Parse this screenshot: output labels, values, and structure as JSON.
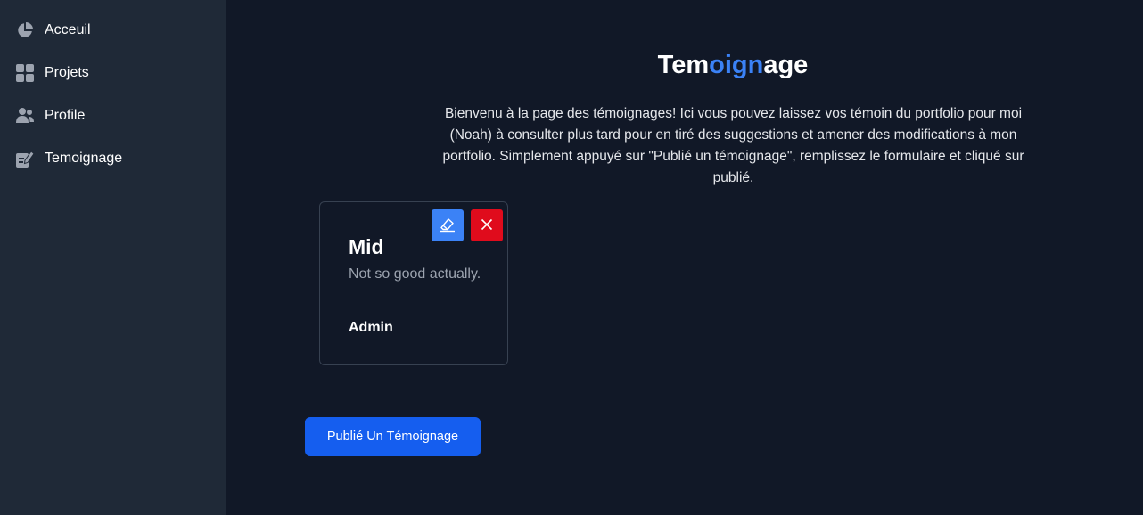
{
  "sidebar": {
    "items": [
      {
        "label": "Acceuil",
        "icon": "chart-pie-icon"
      },
      {
        "label": "Projets",
        "icon": "grid-icon"
      },
      {
        "label": "Profile",
        "icon": "users-icon"
      },
      {
        "label": "Temoignage",
        "icon": "pen-note-icon"
      }
    ]
  },
  "main": {
    "title_parts": [
      "Tem",
      "oign",
      "age"
    ],
    "intro": "Bienvenu à la page des témoignages! Ici vous pouvez laissez vos témoin du portfolio pour moi (Noah) à consulter plus tard pour en tiré des suggestions et amener des modifications à mon portfolio. Simplement appuyé sur \"Publié un témoignage\", remplissez le formulaire et cliqué sur publié.",
    "testimonials": [
      {
        "title": "Mid",
        "text": "Not so good actually.",
        "author": "Admin"
      }
    ],
    "publish_button": "Publié Un Témoignage"
  },
  "colors": {
    "sidebar_bg": "#1f2937",
    "main_bg": "#111827",
    "accent": "#3b82f6",
    "primary_button": "#155eef",
    "delete_button": "#e00b1c"
  }
}
